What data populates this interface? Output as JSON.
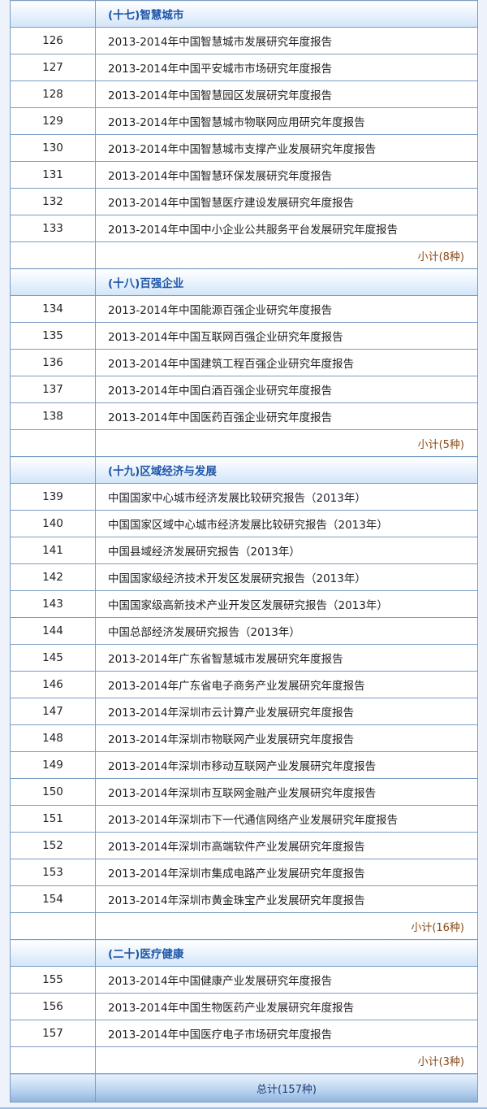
{
  "sections": [
    {
      "title": "(十七)智慧城市",
      "items": [
        {
          "num": "126",
          "title": "2013-2014年中国智慧城市发展研究年度报告"
        },
        {
          "num": "127",
          "title": "2013-2014年中国平安城市市场研究年度报告"
        },
        {
          "num": "128",
          "title": "2013-2014年中国智慧园区发展研究年度报告"
        },
        {
          "num": "129",
          "title": "2013-2014年中国智慧城市物联网应用研究年度报告"
        },
        {
          "num": "130",
          "title": "2013-2014年中国智慧城市支撑产业发展研究年度报告"
        },
        {
          "num": "131",
          "title": "2013-2014年中国智慧环保发展研究年度报告"
        },
        {
          "num": "132",
          "title": "2013-2014年中国智慧医疗建设发展研究年度报告"
        },
        {
          "num": "133",
          "title": "2013-2014年中国中小企业公共服务平台发展研究年度报告"
        }
      ],
      "subtotal": "小计(8种)"
    },
    {
      "title": "(十八)百强企业",
      "items": [
        {
          "num": "134",
          "title": "2013-2014年中国能源百强企业研究年度报告"
        },
        {
          "num": "135",
          "title": "2013-2014年中国互联网百强企业研究年度报告"
        },
        {
          "num": "136",
          "title": "2013-2014年中国建筑工程百强企业研究年度报告"
        },
        {
          "num": "137",
          "title": "2013-2014年中国白酒百强企业研究年度报告"
        },
        {
          "num": "138",
          "title": "2013-2014年中国医药百强企业研究年度报告"
        }
      ],
      "subtotal": "小计(5种)"
    },
    {
      "title": "(十九)区域经济与发展",
      "items": [
        {
          "num": "139",
          "title": "中国国家中心城市经济发展比较研究报告（2013年）"
        },
        {
          "num": "140",
          "title": "中国国家区域中心城市经济发展比较研究报告（2013年）"
        },
        {
          "num": "141",
          "title": "中国县域经济发展研究报告（2013年）"
        },
        {
          "num": "142",
          "title": "中国国家级经济技术开发区发展研究报告（2013年）"
        },
        {
          "num": "143",
          "title": "中国国家级高新技术产业开发区发展研究报告（2013年）"
        },
        {
          "num": "144",
          "title": "中国总部经济发展研究报告（2013年）"
        },
        {
          "num": "145",
          "title": "2013-2014年广东省智慧城市发展研究年度报告"
        },
        {
          "num": "146",
          "title": "2013-2014年广东省电子商务产业发展研究年度报告"
        },
        {
          "num": "147",
          "title": "2013-2014年深圳市云计算产业发展研究年度报告"
        },
        {
          "num": "148",
          "title": "2013-2014年深圳市物联网产业发展研究年度报告"
        },
        {
          "num": "149",
          "title": "2013-2014年深圳市移动互联网产业发展研究年度报告"
        },
        {
          "num": "150",
          "title": "2013-2014年深圳市互联网金融产业发展研究年度报告"
        },
        {
          "num": "151",
          "title": "2013-2014年深圳市下一代通信网络产业发展研究年度报告"
        },
        {
          "num": "152",
          "title": "2013-2014年深圳市高端软件产业发展研究年度报告"
        },
        {
          "num": "153",
          "title": "2013-2014年深圳市集成电路产业发展研究年度报告"
        },
        {
          "num": "154",
          "title": "2013-2014年深圳市黄金珠宝产业发展研究年度报告"
        }
      ],
      "subtotal": "小计(16种)"
    },
    {
      "title": "(二十)医疗健康",
      "items": [
        {
          "num": "155",
          "title": "2013-2014年中国健康产业发展研究年度报告"
        },
        {
          "num": "156",
          "title": "2013-2014年中国生物医药产业发展研究年度报告"
        },
        {
          "num": "157",
          "title": "2013-2014年中国医疗电子市场研究年度报告"
        }
      ],
      "subtotal": "小计(3种)"
    }
  ],
  "total": "总计(157种)"
}
